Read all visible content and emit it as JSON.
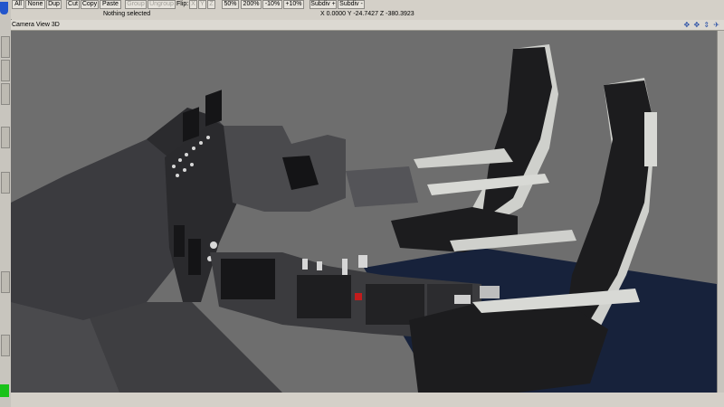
{
  "toolbar": {
    "all": "All",
    "none": "None",
    "dup": "Dup",
    "cut": "Cut",
    "copy": "Copy",
    "paste": "Paste",
    "group": "Group",
    "ungroup": "Ungroup",
    "flip_label": "Flip:",
    "flip_x": "X",
    "flip_y": "Y",
    "flip_z": "Z",
    "zoom_50": "50%",
    "zoom_200": "200%",
    "zoom_minus10": "-10%",
    "zoom_plus10": "+10%",
    "subdiv_plus": "Subdiv +",
    "subdiv_minus": "Subdiv -"
  },
  "status": {
    "selection": "Nothing selected",
    "coords": "X 0.0000 Y -24.7427 Z -380.3923"
  },
  "viewport": {
    "title": "Camera View 3D",
    "nav_icons": "✥ ✥ ⇕ ✈"
  },
  "colors": {
    "ui_bg": "#d4d0c8",
    "viewport_bg": "#6e6e6e",
    "floor_carpet": "#17223b",
    "seat_dark": "#1c1c1e",
    "seat_light": "#cfd0cc",
    "cockpit_shell": "#3b3b3f"
  }
}
